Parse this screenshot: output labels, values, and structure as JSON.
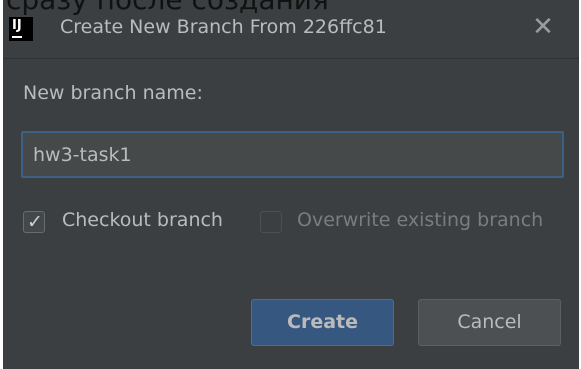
{
  "caption": "сразу после создания",
  "dialog": {
    "title": "Create New Branch From 226ffc81",
    "close_glyph": "✕",
    "field_label": "New branch name:",
    "branch_name_value": "hw3-task1",
    "checkout": {
      "label": "Checkout branch",
      "checked": true,
      "check_glyph": "✓"
    },
    "overwrite": {
      "label": "Overwrite existing branch",
      "checked": false,
      "enabled": false
    },
    "create_label": "Create",
    "cancel_label": "Cancel"
  },
  "colors": {
    "dialog_bg": "#3c3f41",
    "primary_button": "#365880",
    "input_focus_border": "#3d6185"
  },
  "icons": {
    "app": "intellij-app-icon",
    "close": "close-icon",
    "check": "checkmark-icon"
  }
}
